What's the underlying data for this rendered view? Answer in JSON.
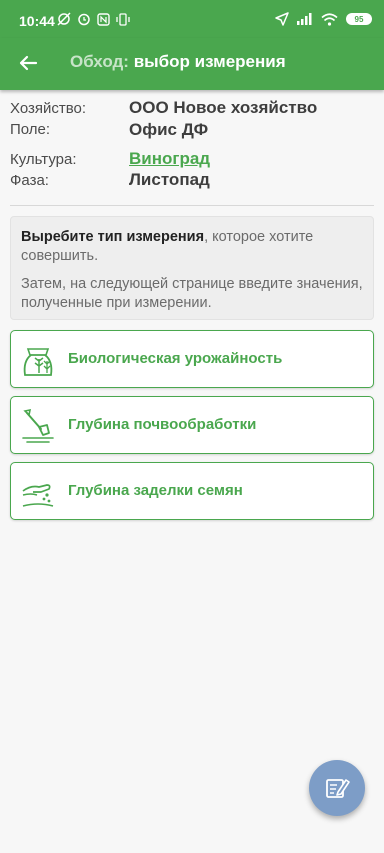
{
  "status_bar": {
    "time": "10:44",
    "battery": "95"
  },
  "app_bar": {
    "title_prefix": "Обход:",
    "title_main": "выбор измерения"
  },
  "info": {
    "farm_label": "Хозяйство:",
    "farm_value": "ООО Новое хозяйство",
    "field_label": "Поле:",
    "field_value": "Офис ДФ",
    "crop_label": "Культура:",
    "crop_value": "Виноград",
    "phase_label": "Фаза:",
    "phase_value": "Листопад"
  },
  "hint": {
    "bold": "Выребите тип измерения",
    "rest": ", которое хотите совершить.",
    "second": "Затем, на следующей странице введите значения, полученные при измерении."
  },
  "options": [
    {
      "label": "Биологическая урожайность",
      "icon": "wheat-bag-icon"
    },
    {
      "label": "Глубина почвообработки",
      "icon": "shovel-icon"
    },
    {
      "label": "Глубина заделки семян",
      "icon": "seed-hand-icon"
    }
  ],
  "colors": {
    "primary": "#4aa74e",
    "fab": "#7d9dc7",
    "background": "#f7f7f7"
  }
}
